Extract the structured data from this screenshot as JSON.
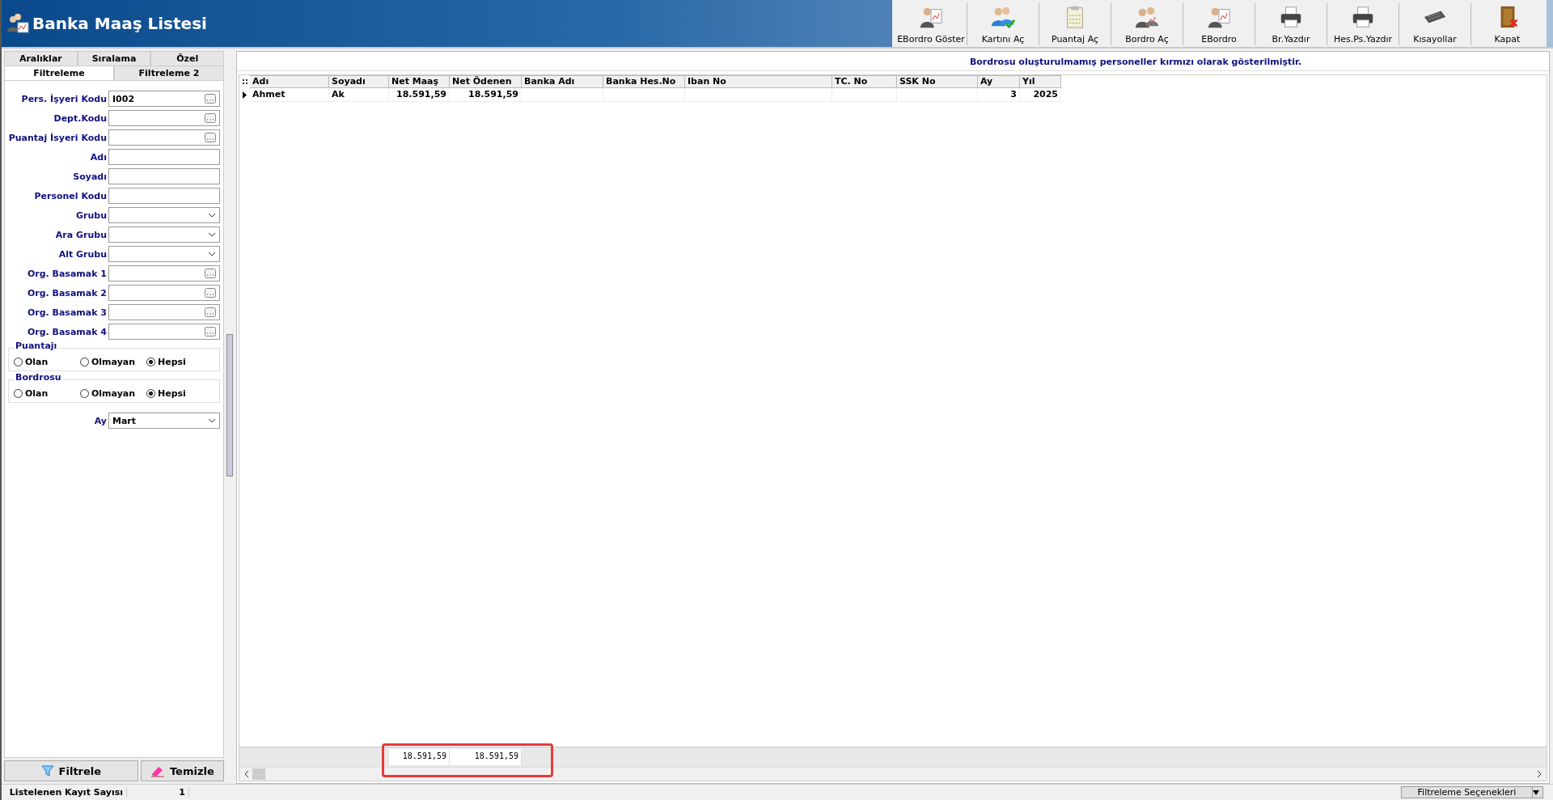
{
  "window": {
    "title": "Banka Maaş Listesi"
  },
  "toolbar": [
    {
      "label": "EBordro Göster",
      "kind": "report"
    },
    {
      "label": "Kartını Aç",
      "kind": "card"
    },
    {
      "label": "Puantaj Aç",
      "kind": "clipboard"
    },
    {
      "label": "Bordro Aç",
      "kind": "people"
    },
    {
      "label": "EBordro",
      "kind": "report"
    },
    {
      "label": "Br.Yazdır",
      "kind": "printer"
    },
    {
      "label": "Hes.Ps.Yazdır",
      "kind": "printer"
    },
    {
      "label": "Kısayollar",
      "kind": "keyboard"
    },
    {
      "label": "Kapat",
      "kind": "door"
    }
  ],
  "tabs_top": [
    {
      "label": "Aralıklar",
      "selected": false
    },
    {
      "label": "Sıralama",
      "selected": false
    },
    {
      "label": "Özel",
      "selected": false
    }
  ],
  "tabs": [
    {
      "label": "Filtreleme",
      "selected": true
    },
    {
      "label": "Filtreleme 2",
      "selected": false
    }
  ],
  "fields": [
    {
      "label": "Pers. İşyeri Kodu",
      "kind": "lookup",
      "value": "I002"
    },
    {
      "label": "Dept.Kodu",
      "kind": "lookup"
    },
    {
      "label": "Puantaj İsyeri Kodu",
      "kind": "lookup"
    },
    {
      "label": "Adı",
      "kind": "text"
    },
    {
      "label": "Soyadı",
      "kind": "text"
    },
    {
      "label": "Personel Kodu",
      "kind": "text"
    },
    {
      "label": "Grubu",
      "kind": "combo"
    },
    {
      "label": "Ara Grubu",
      "kind": "combo"
    },
    {
      "label": "Alt Grubu",
      "kind": "combo"
    },
    {
      "label": "Org. Basamak 1",
      "kind": "lookup"
    },
    {
      "label": "Org. Basamak 2",
      "kind": "lookup"
    },
    {
      "label": "Org. Basamak 3",
      "kind": "lookup"
    },
    {
      "label": "Org. Basamak 4",
      "kind": "lookup"
    }
  ],
  "radio_groups": [
    {
      "title": "Puantajı",
      "options": [
        {
          "label": "Olan",
          "selected": false
        },
        {
          "label": "Olmayan",
          "selected": false
        },
        {
          "label": "Hepsi",
          "selected": true
        }
      ]
    },
    {
      "title": "Bordrosu",
      "options": [
        {
          "label": "Olan",
          "selected": false
        },
        {
          "label": "Olmayan",
          "selected": false
        },
        {
          "label": "Hepsi",
          "selected": true
        }
      ]
    }
  ],
  "month": {
    "label": "Ay",
    "value": "Mart"
  },
  "buttons": [
    {
      "label": "Filtrele",
      "kind": "filter"
    },
    {
      "label": "Temizle",
      "kind": "eraser"
    }
  ],
  "notice": "Bordrosu oluşturulmamış personeller kırmızı olarak gösterilmiştir.",
  "table": {
    "columns": [
      {
        "label": "Adı"
      },
      {
        "label": "Soyadı"
      },
      {
        "label": "Net Maaş"
      },
      {
        "label": "Net Ödenen"
      },
      {
        "label": "Banka Adı"
      },
      {
        "label": "Banka Hes.No"
      },
      {
        "label": "Iban No"
      },
      {
        "label": "TC. No"
      },
      {
        "label": "SSK No"
      },
      {
        "label": "Ay"
      },
      {
        "label": "Yıl"
      }
    ],
    "rows": [
      {
        "selected": true,
        "cells": [
          "Ahmet",
          "Ak",
          "18.591,59",
          "18.591,59",
          "",
          "",
          "",
          "",
          "",
          "3",
          "2025"
        ]
      }
    ],
    "totals": {
      "net_maas": "18.591,59",
      "net_odenen": "18.591,59"
    }
  },
  "status_bar": {
    "label": "Listelenen Kayıt Sayısı",
    "count": "1",
    "options_button": "Filtreleme Seçenekleri"
  }
}
